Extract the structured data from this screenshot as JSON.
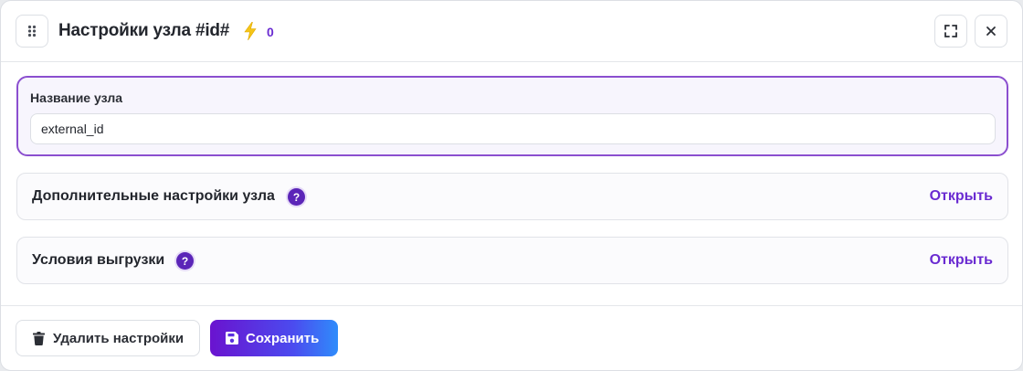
{
  "header": {
    "title": "Настройки узла #id#",
    "count": "0",
    "drag_icon": "grip-dots-icon",
    "bolt_icon": "lightning-bolt-icon",
    "expand_icon": "expand-icon",
    "close_icon": "close-icon"
  },
  "name_field": {
    "label": "Название узла",
    "value": "external_id"
  },
  "sections": [
    {
      "title": "Дополнительные настройки узла",
      "help": "?",
      "action": "Открыть"
    },
    {
      "title": "Условия выгрузки",
      "help": "?",
      "action": "Открыть"
    }
  ],
  "footer": {
    "delete_label": "Удалить настройки",
    "save_label": "Сохранить",
    "delete_icon": "trash-icon",
    "save_icon": "floppy-disk-icon"
  },
  "colors": {
    "accent": "#6a2bd1",
    "help_badge": "#5b25b8",
    "active_border": "#8b4fcf",
    "save_gradient_start": "#6a13cf",
    "save_gradient_end": "#2f8cfb",
    "bolt": "#f5c518"
  }
}
